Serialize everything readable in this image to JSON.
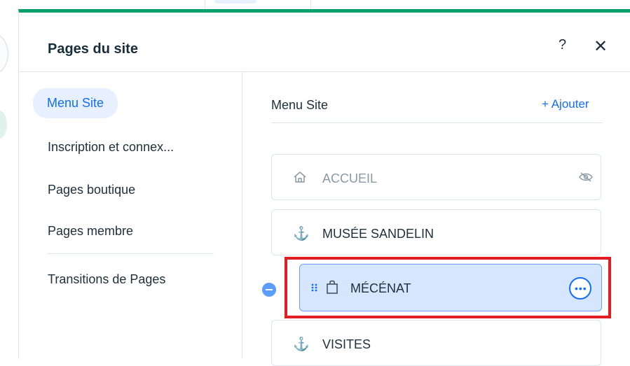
{
  "panel": {
    "title": "Pages du site",
    "help_label": "?",
    "close_label": "✕"
  },
  "sidebar": {
    "items": [
      {
        "label": "Menu Site"
      },
      {
        "label": "Inscription et connex..."
      },
      {
        "label": "Pages boutique"
      },
      {
        "label": "Pages membre"
      },
      {
        "label": "Transitions de Pages"
      }
    ]
  },
  "main": {
    "title": "Menu Site",
    "add_label": "+ Ajouter",
    "pages": [
      {
        "label": "ACCUEIL",
        "icon": "⌂",
        "icon_name": "home-icon",
        "hidden": true
      },
      {
        "label": "MUSÉE SANDELIN",
        "icon": "⚓",
        "icon_name": "anchor-icon"
      },
      {
        "label": "MÉCÉNAT",
        "icon": "⌂",
        "icon_name": "shopping-bag-icon",
        "selected": true
      },
      {
        "label": "VISITES",
        "icon": "⚓",
        "icon_name": "anchor-icon"
      }
    ]
  },
  "colors": {
    "accent": "#116dff",
    "header_border": "#0aa06e",
    "selected_bg": "#d6e6fe",
    "highlight": "#e31b23"
  }
}
